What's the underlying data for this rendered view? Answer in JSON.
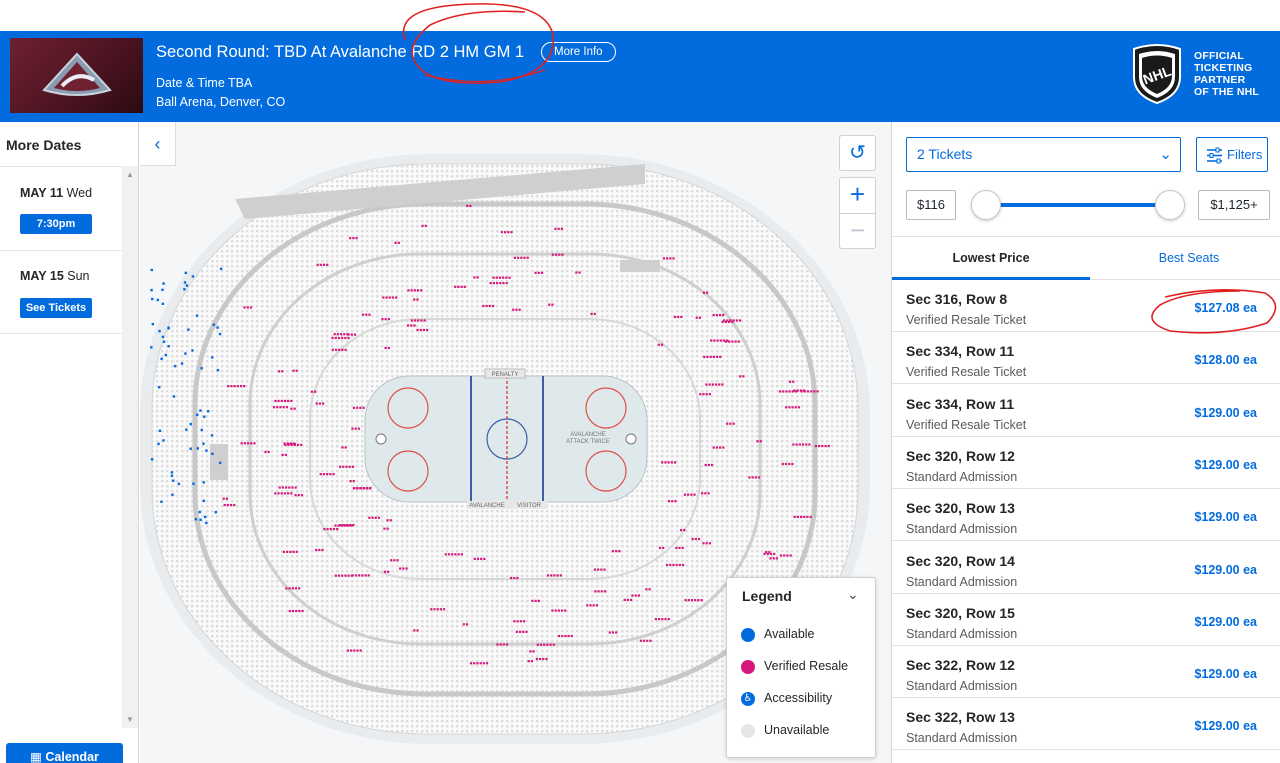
{
  "header": {
    "event_title": "Second Round: TBD At Avalanche RD 2 HM GM 1",
    "more_info_label": "More Info",
    "date_time": "Date & Time TBA",
    "venue": "Ball Arena, Denver, CO",
    "partner_lines": [
      "OFFICIAL",
      "TICKETING",
      "PARTNER",
      "OF THE NHL"
    ],
    "partner_logo_text": "NHL"
  },
  "dates": {
    "title": "More Dates",
    "items": [
      {
        "date": "MAY 11",
        "weekday": "Wed",
        "button": "7:30pm"
      },
      {
        "date": "MAY 15",
        "weekday": "Sun",
        "button": "See Tickets"
      }
    ],
    "calendar_label": "Calendar"
  },
  "map": {
    "rink_labels": {
      "penalty": "PENALTY",
      "attack_line1": "AVALANCHE",
      "attack_line2": "ATTACK TWICE",
      "home_bench": "AVALANCHE",
      "visitor_bench": "VISITOR"
    },
    "legend": {
      "title": "Legend",
      "items": [
        {
          "label": "Available",
          "color": "#026cdf"
        },
        {
          "label": "Verified Resale",
          "color": "#d6177b"
        },
        {
          "label": "Accessibility",
          "color": "#026cdf"
        },
        {
          "label": "Unavailable",
          "color": "#e6e6e6"
        }
      ]
    }
  },
  "filters": {
    "tickets_value": "2 Tickets",
    "filters_label": "Filters",
    "price_min": "$116",
    "price_max": "$1,125+",
    "tabs": [
      "Lowest Price",
      "Best Seats"
    ]
  },
  "listings": [
    {
      "section": "Sec 316, Row 8",
      "type": "Verified Resale Ticket",
      "price": "$127.08 ea"
    },
    {
      "section": "Sec 334, Row 11",
      "type": "Verified Resale Ticket",
      "price": "$128.00 ea"
    },
    {
      "section": "Sec 334, Row 11",
      "type": "Verified Resale Ticket",
      "price": "$129.00 ea"
    },
    {
      "section": "Sec 320, Row 12",
      "type": "Standard Admission",
      "price": "$129.00 ea"
    },
    {
      "section": "Sec 320, Row 13",
      "type": "Standard Admission",
      "price": "$129.00 ea"
    },
    {
      "section": "Sec 320, Row 14",
      "type": "Standard Admission",
      "price": "$129.00 ea"
    },
    {
      "section": "Sec 320, Row 15",
      "type": "Standard Admission",
      "price": "$129.00 ea"
    },
    {
      "section": "Sec 322, Row 12",
      "type": "Standard Admission",
      "price": "$129.00 ea"
    },
    {
      "section": "Sec 322, Row 13",
      "type": "Standard Admission",
      "price": "$129.00 ea"
    }
  ],
  "colors": {
    "brand_blue": "#026cdf",
    "resale_pink": "#d6177b",
    "annotation_red": "#e02020"
  }
}
